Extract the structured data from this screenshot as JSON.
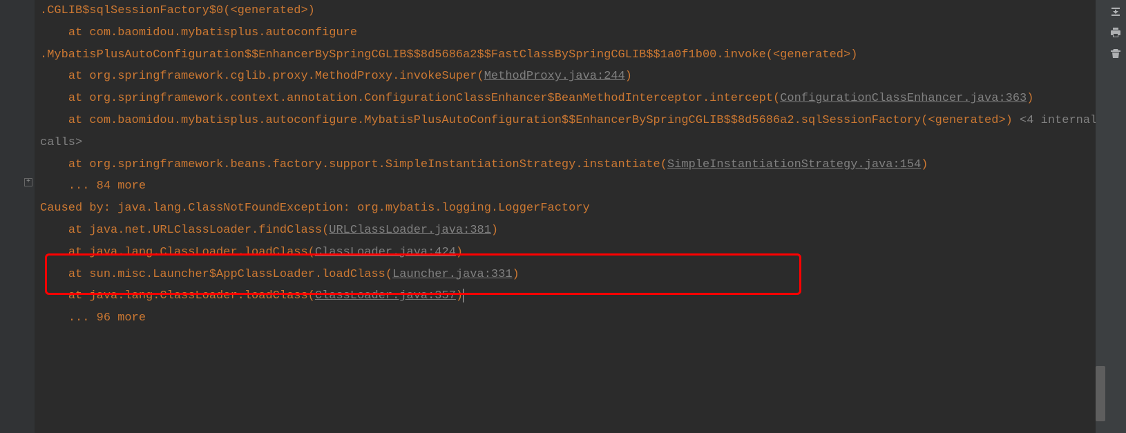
{
  "console": {
    "lines": [
      {
        "type": "stack",
        "prefix": ".CGLIB$sqlSessionFactory$0(",
        "link": "",
        "suffix": "<generated>)"
      },
      {
        "type": "stack",
        "prefix": "    at com.baomidou.mybatisplus.autoconfigure",
        "link": "",
        "suffix": ""
      },
      {
        "type": "stack",
        "prefix": ".MybatisPlusAutoConfiguration$$EnhancerBySpringCGLIB$$8d5686a2$$FastClassBySpringCGLIB$$1a0f1b00.invoke(",
        "link": "",
        "suffix": "<generated>)"
      },
      {
        "type": "stack",
        "prefix": "    at org.springframework.cglib.proxy.MethodProxy.invokeSuper(",
        "link": "MethodProxy.java:244",
        "suffix": ")"
      },
      {
        "type": "stack",
        "prefix": "    at org.springframework.context.annotation.ConfigurationClassEnhancer$BeanMethodInterceptor.intercept(",
        "link": "ConfigurationClassEnhancer.java:363",
        "suffix": ")"
      },
      {
        "type": "stack-collapsed",
        "prefix": "    at com.baomidou.mybatisplus.autoconfigure.MybatisPlusAutoConfiguration$$EnhancerBySpringCGLIB$$8d5686a2.sqlSessionFactory(",
        "link": "",
        "suffix": "<generated>)",
        "collapsed": " <4 internal calls>"
      },
      {
        "type": "stack",
        "prefix": "    at org.springframework.beans.factory.support.SimpleInstantiationStrategy.instantiate(",
        "link": "SimpleInstantiationStrategy.java:154",
        "suffix": ")"
      },
      {
        "type": "stack",
        "prefix": "    ... 84 more",
        "link": "",
        "suffix": ""
      },
      {
        "type": "stack",
        "prefix": "Caused by: java.lang.ClassNotFoundException: org.mybatis.logging.LoggerFactory",
        "link": "",
        "suffix": ""
      },
      {
        "type": "stack",
        "prefix": "    at java.net.URLClassLoader.findClass(",
        "link": "URLClassLoader.java:381",
        "suffix": ")"
      },
      {
        "type": "stack",
        "prefix": "    at java.lang.ClassLoader.loadClass(",
        "link": "ClassLoader.java:424",
        "suffix": ")"
      },
      {
        "type": "stack",
        "prefix": "    at sun.misc.Launcher$AppClassLoader.loadClass(",
        "link": "Launcher.java:331",
        "suffix": ")"
      },
      {
        "type": "stack",
        "prefix": "    at java.lang.ClassLoader.loadClass(",
        "link": "ClassLoader.java:357",
        "suffix": ")"
      },
      {
        "type": "stack",
        "prefix": "    ... 96 more",
        "link": "",
        "suffix": ""
      }
    ]
  },
  "expand_marker": "+",
  "toolbar": {
    "scroll_to_end": "scroll-to-end",
    "print": "print",
    "clear": "clear"
  }
}
